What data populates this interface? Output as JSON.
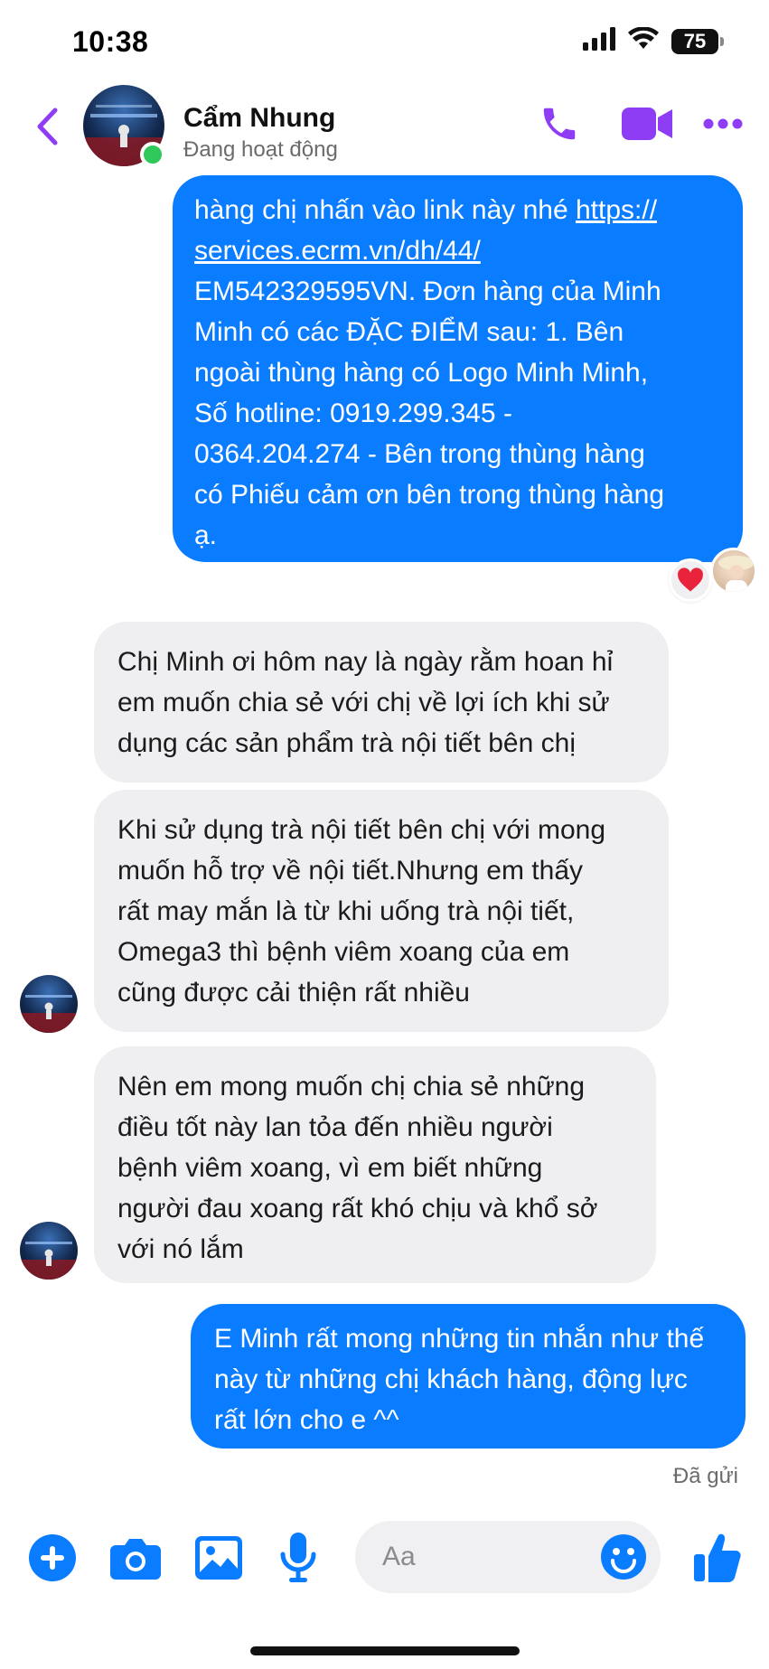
{
  "status_bar": {
    "time": "10:38",
    "battery": "75"
  },
  "header": {
    "contact_name": "Cẩm Nhung",
    "contact_status": "Đang hoạt động"
  },
  "messages": [
    {
      "direction": "outgoing",
      "lines": [
        "hàng chị nhấn vào link này nhé https://",
        "services.ecrm.vn/dh/44/",
        "EM542329595VN. Đơn hàng của Minh",
        "Minh có các ĐẶC ĐIỂM sau: 1. Bên",
        "ngoài thùng hàng có Logo Minh Minh,",
        "Số hotline: 0919.299.345 -",
        "0364.204.274 -  Bên trong thùng hàng",
        "có Phiếu cảm ơn bên trong thùng hàng",
        "ạ."
      ],
      "link_prefix": "hàng chị nhấn vào link này nhé ",
      "link_text": "https://",
      "reaction": "heart"
    },
    {
      "direction": "incoming",
      "lines": [
        "Chị Minh ơi hôm nay là ngày rằm hoan hỉ",
        "em muốn chia sẻ với chị về lợi ích khi sử",
        "dụng các sản phẩm trà nội tiết bên chị"
      ]
    },
    {
      "direction": "incoming",
      "lines": [
        "Khi sử dụng trà nội tiết bên chị với mong",
        "muốn hỗ trợ về nội tiết.Nhưng em thấy",
        "rất may mắn là từ khi uống trà nội tiết,",
        "Omega3 thì bệnh viêm xoang của em",
        "cũng được cải thiện rất nhiều"
      ]
    },
    {
      "direction": "incoming",
      "lines": [
        "Nên em mong muốn chị chia sẻ những",
        "điều tốt này lan tỏa đến nhiều người",
        "bệnh viêm xoang, vì em biết những",
        "người đau xoang rất khó chịu và khổ sở",
        "với nó lắm"
      ]
    },
    {
      "direction": "outgoing",
      "lines": [
        "E Minh rất mong những tin nhắn như thế",
        "này từ những chị khách hàng, động lực",
        "rất lớn cho e ^^"
      ]
    }
  ],
  "sent_status": "Đã gửi",
  "composer": {
    "placeholder": "Aa"
  },
  "colors": {
    "accent": "#0a7cff",
    "header_accent": "#8e3df5",
    "incoming_bubble": "#efeff2",
    "online": "#2fc85a",
    "reaction": "#e8233b"
  },
  "icons": [
    "back-chevron",
    "phone",
    "video-camera",
    "more-dots",
    "plus",
    "camera",
    "photo",
    "microphone",
    "emoji",
    "thumbs-up",
    "heart"
  ]
}
